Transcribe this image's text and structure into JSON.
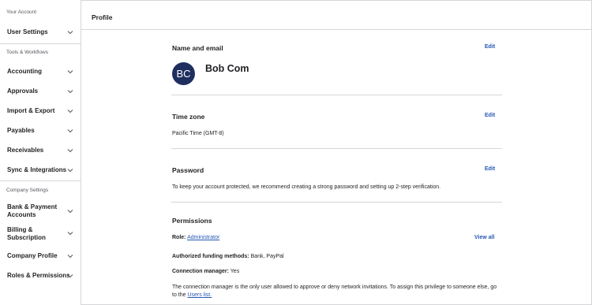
{
  "sidebar": {
    "sections": [
      {
        "heading": "Your Account"
      },
      {
        "heading": "Tools & Workflows"
      },
      {
        "heading": "Company Settings"
      }
    ],
    "items": [
      {
        "label": "User Settings"
      },
      {
        "label": "Accounting"
      },
      {
        "label": "Approvals"
      },
      {
        "label": "Import & Export"
      },
      {
        "label": "Payables"
      },
      {
        "label": "Receivables"
      },
      {
        "label": "Sync & Integrations"
      },
      {
        "label": "Bank & Payment\nAccounts"
      },
      {
        "label": "Billing &\nSubscription"
      },
      {
        "label": "Company Profile"
      },
      {
        "label": "Roles & Permissions"
      }
    ]
  },
  "header": {
    "title": "Profile"
  },
  "name_email": {
    "title": "Name and email",
    "edit_label": "Edit",
    "avatar_initials": "BC",
    "user_name": "Bob Com"
  },
  "timezone": {
    "title": "Time zone",
    "edit_label": "Edit",
    "value": "Pacific Time (GMT-8)"
  },
  "password": {
    "title": "Password",
    "edit_label": "Edit",
    "description": "To keep your account protected, we recommend creating a strong password and setting up 2-step verification."
  },
  "permissions": {
    "title": "Permissions",
    "role_label": "Role:",
    "role_value": "Administrator",
    "view_all_label": "View all",
    "funding_label": "Authorized funding methods:",
    "funding_value": "Bank, PayPal",
    "connection_label": "Connection manager:",
    "connection_value": "Yes",
    "note_line1": "The connection manager is the only user allowed to approve or deny network invitations. To assign this privilege to someone else, go",
    "note_prefix": "to the ",
    "note_link": "Users list."
  },
  "colors": {
    "accent": "#2658b5",
    "avatar_bg": "#1e2e5e",
    "border": "#d5d6da"
  }
}
